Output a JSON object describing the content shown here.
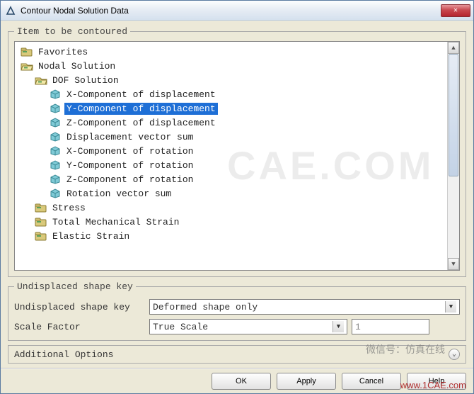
{
  "window": {
    "title": "Contour Nodal Solution Data"
  },
  "groupbox": {
    "item_title": "Item to be contoured",
    "shape_title": "Undisplaced shape key"
  },
  "tree": [
    {
      "label": "Favorites",
      "indent": 0,
      "type": "folder",
      "selected": false
    },
    {
      "label": "Nodal Solution",
      "indent": 0,
      "type": "folder-open",
      "selected": false
    },
    {
      "label": "DOF Solution",
      "indent": 1,
      "type": "folder-open",
      "selected": false
    },
    {
      "label": "X-Component of displacement",
      "indent": 2,
      "type": "leaf",
      "selected": false
    },
    {
      "label": "Y-Component of displacement",
      "indent": 2,
      "type": "leaf",
      "selected": true
    },
    {
      "label": "Z-Component of displacement",
      "indent": 2,
      "type": "leaf",
      "selected": false
    },
    {
      "label": "Displacement vector sum",
      "indent": 2,
      "type": "leaf",
      "selected": false
    },
    {
      "label": "X-Component of rotation",
      "indent": 2,
      "type": "leaf",
      "selected": false
    },
    {
      "label": "Y-Component of rotation",
      "indent": 2,
      "type": "leaf",
      "selected": false
    },
    {
      "label": "Z-Component of rotation",
      "indent": 2,
      "type": "leaf",
      "selected": false
    },
    {
      "label": "Rotation vector sum",
      "indent": 2,
      "type": "leaf",
      "selected": false
    },
    {
      "label": "Stress",
      "indent": 1,
      "type": "folder",
      "selected": false
    },
    {
      "label": "Total Mechanical Strain",
      "indent": 1,
      "type": "folder",
      "selected": false
    },
    {
      "label": "Elastic Strain",
      "indent": 1,
      "type": "folder",
      "selected": false
    }
  ],
  "form": {
    "shape_key_label": "Undisplaced shape key",
    "shape_key_value": "Deformed shape only",
    "scale_label": "Scale Factor",
    "scale_value": "True Scale",
    "scale_number": "1"
  },
  "additional": {
    "label": "Additional Options"
  },
  "buttons": {
    "ok": "OK",
    "apply": "Apply",
    "cancel": "Cancel",
    "help": "Help"
  },
  "watermarks": {
    "big": "CAE.COM",
    "wx": "微信号：仿真在线",
    "url": "www.1CAE.com"
  }
}
